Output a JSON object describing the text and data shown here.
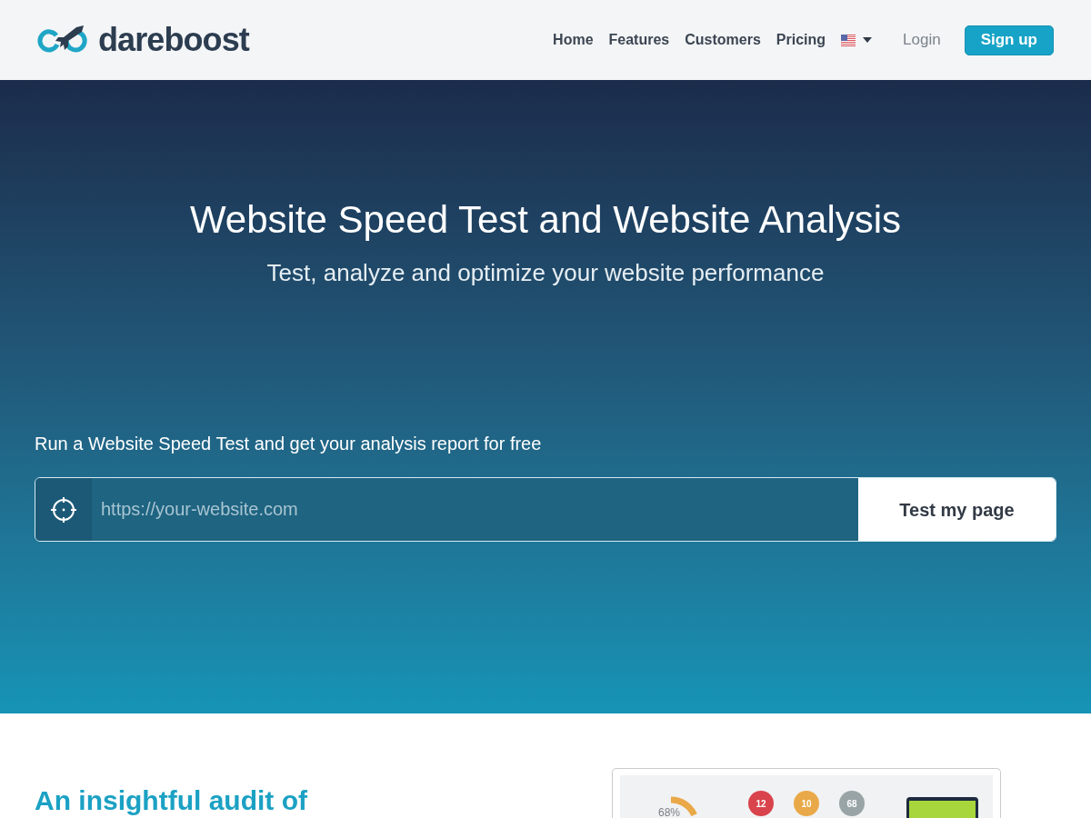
{
  "header": {
    "logo": {
      "text": "dareboost"
    },
    "nav": [
      {
        "label": "Home"
      },
      {
        "label": "Features"
      },
      {
        "label": "Customers"
      },
      {
        "label": "Pricing"
      }
    ],
    "login": {
      "label": "Login"
    },
    "signup": {
      "label": "Sign up"
    }
  },
  "hero": {
    "title": "Website Speed Test and Website Analysis",
    "subtitle": "Test, analyze and optimize your website performance",
    "prompt": "Run a Website Speed Test and get your analysis report for free",
    "url_field": {
      "placeholder": "https://your-website.com"
    },
    "submit": {
      "label": "Test my page"
    }
  },
  "audit": {
    "heading": "An insightful audit of",
    "preview": {
      "score": {
        "value": "68%",
        "level": 0.68
      },
      "counts": [
        {
          "value": "12",
          "color": "#d9434b"
        },
        {
          "value": "10",
          "color": "#e9a948"
        },
        {
          "value": "68",
          "color": "#98a4a6"
        }
      ]
    }
  }
}
